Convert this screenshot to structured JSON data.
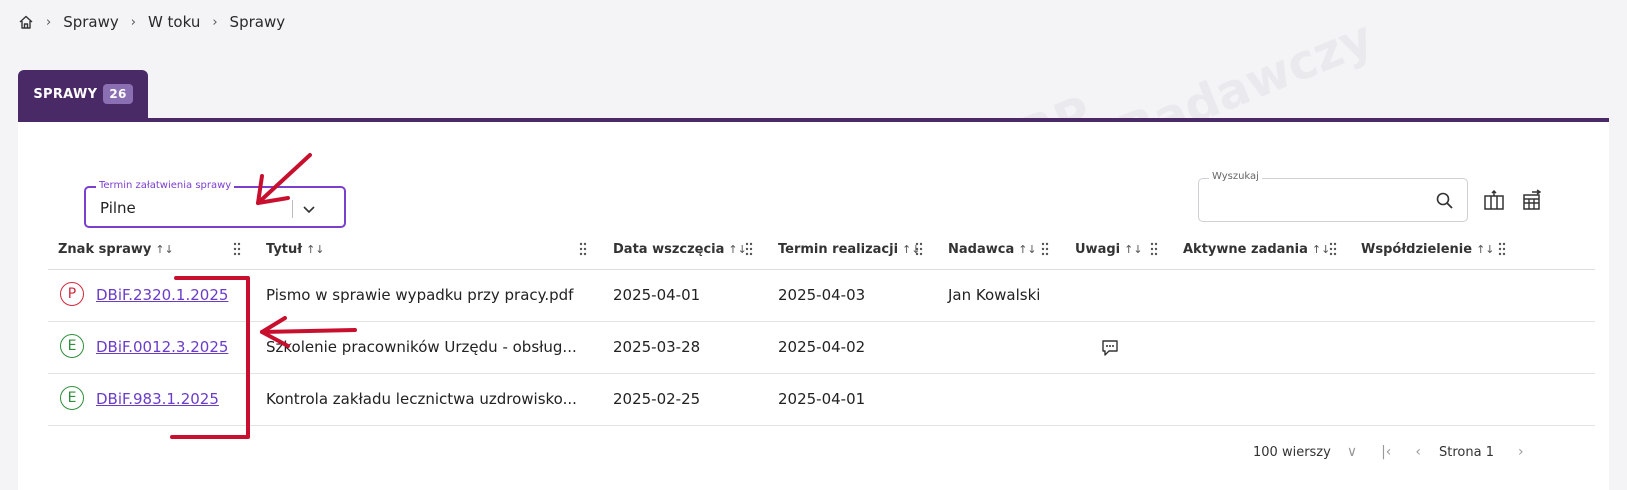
{
  "breadcrumb": {
    "items": [
      "Sprawy",
      "W toku",
      "Sprawy"
    ]
  },
  "tab": {
    "label": "SPRAWY",
    "count": "26"
  },
  "filter": {
    "legend": "Termin załatwienia sprawy",
    "value": "Pilne"
  },
  "search": {
    "placeholder": "Wyszukaj"
  },
  "table": {
    "columns": [
      "Znak sprawy",
      "Tytuł",
      "Data wszczęcia",
      "Termin realizacji",
      "Nadawca",
      "Uwagi",
      "Aktywne zadania",
      "Współdzielenie"
    ],
    "rows": [
      {
        "status": "P",
        "status_color": "#d1293d",
        "znak": "DBiF.2320.1.2025",
        "tytul": "Pismo w sprawie wypadku przy pracy.pdf",
        "data": "2025-04-01",
        "termin": "2025-04-03",
        "nadawca": "Jan Kowalski"
      },
      {
        "status": "E",
        "status_color": "#2f8f3a",
        "znak": "DBiF.0012.3.2025",
        "tytul": "Szkolenie pracowników Urzędu - obsług...",
        "data": "2025-03-28",
        "termin": "2025-04-02",
        "nadawca": ""
      },
      {
        "status": "E",
        "status_color": "#2f8f3a",
        "znak": "DBiF.983.1.2025",
        "tytul": "Kontrola zakładu lecznictwa uzdrowisko...",
        "data": "2025-02-25",
        "termin": "2025-04-01",
        "nadawca": ""
      }
    ]
  },
  "pager": {
    "rows_label": "100 wierszy",
    "page_label": "Strona 1"
  },
  "watermark": "NASK – Państwowy Instytut Badawczy",
  "watermark_logo": "EZD RP",
  "colors": {
    "tab": "#4a2a66",
    "accent": "#7b3fd0",
    "link": "#6a3dc8",
    "annotation": "#c8102e"
  }
}
